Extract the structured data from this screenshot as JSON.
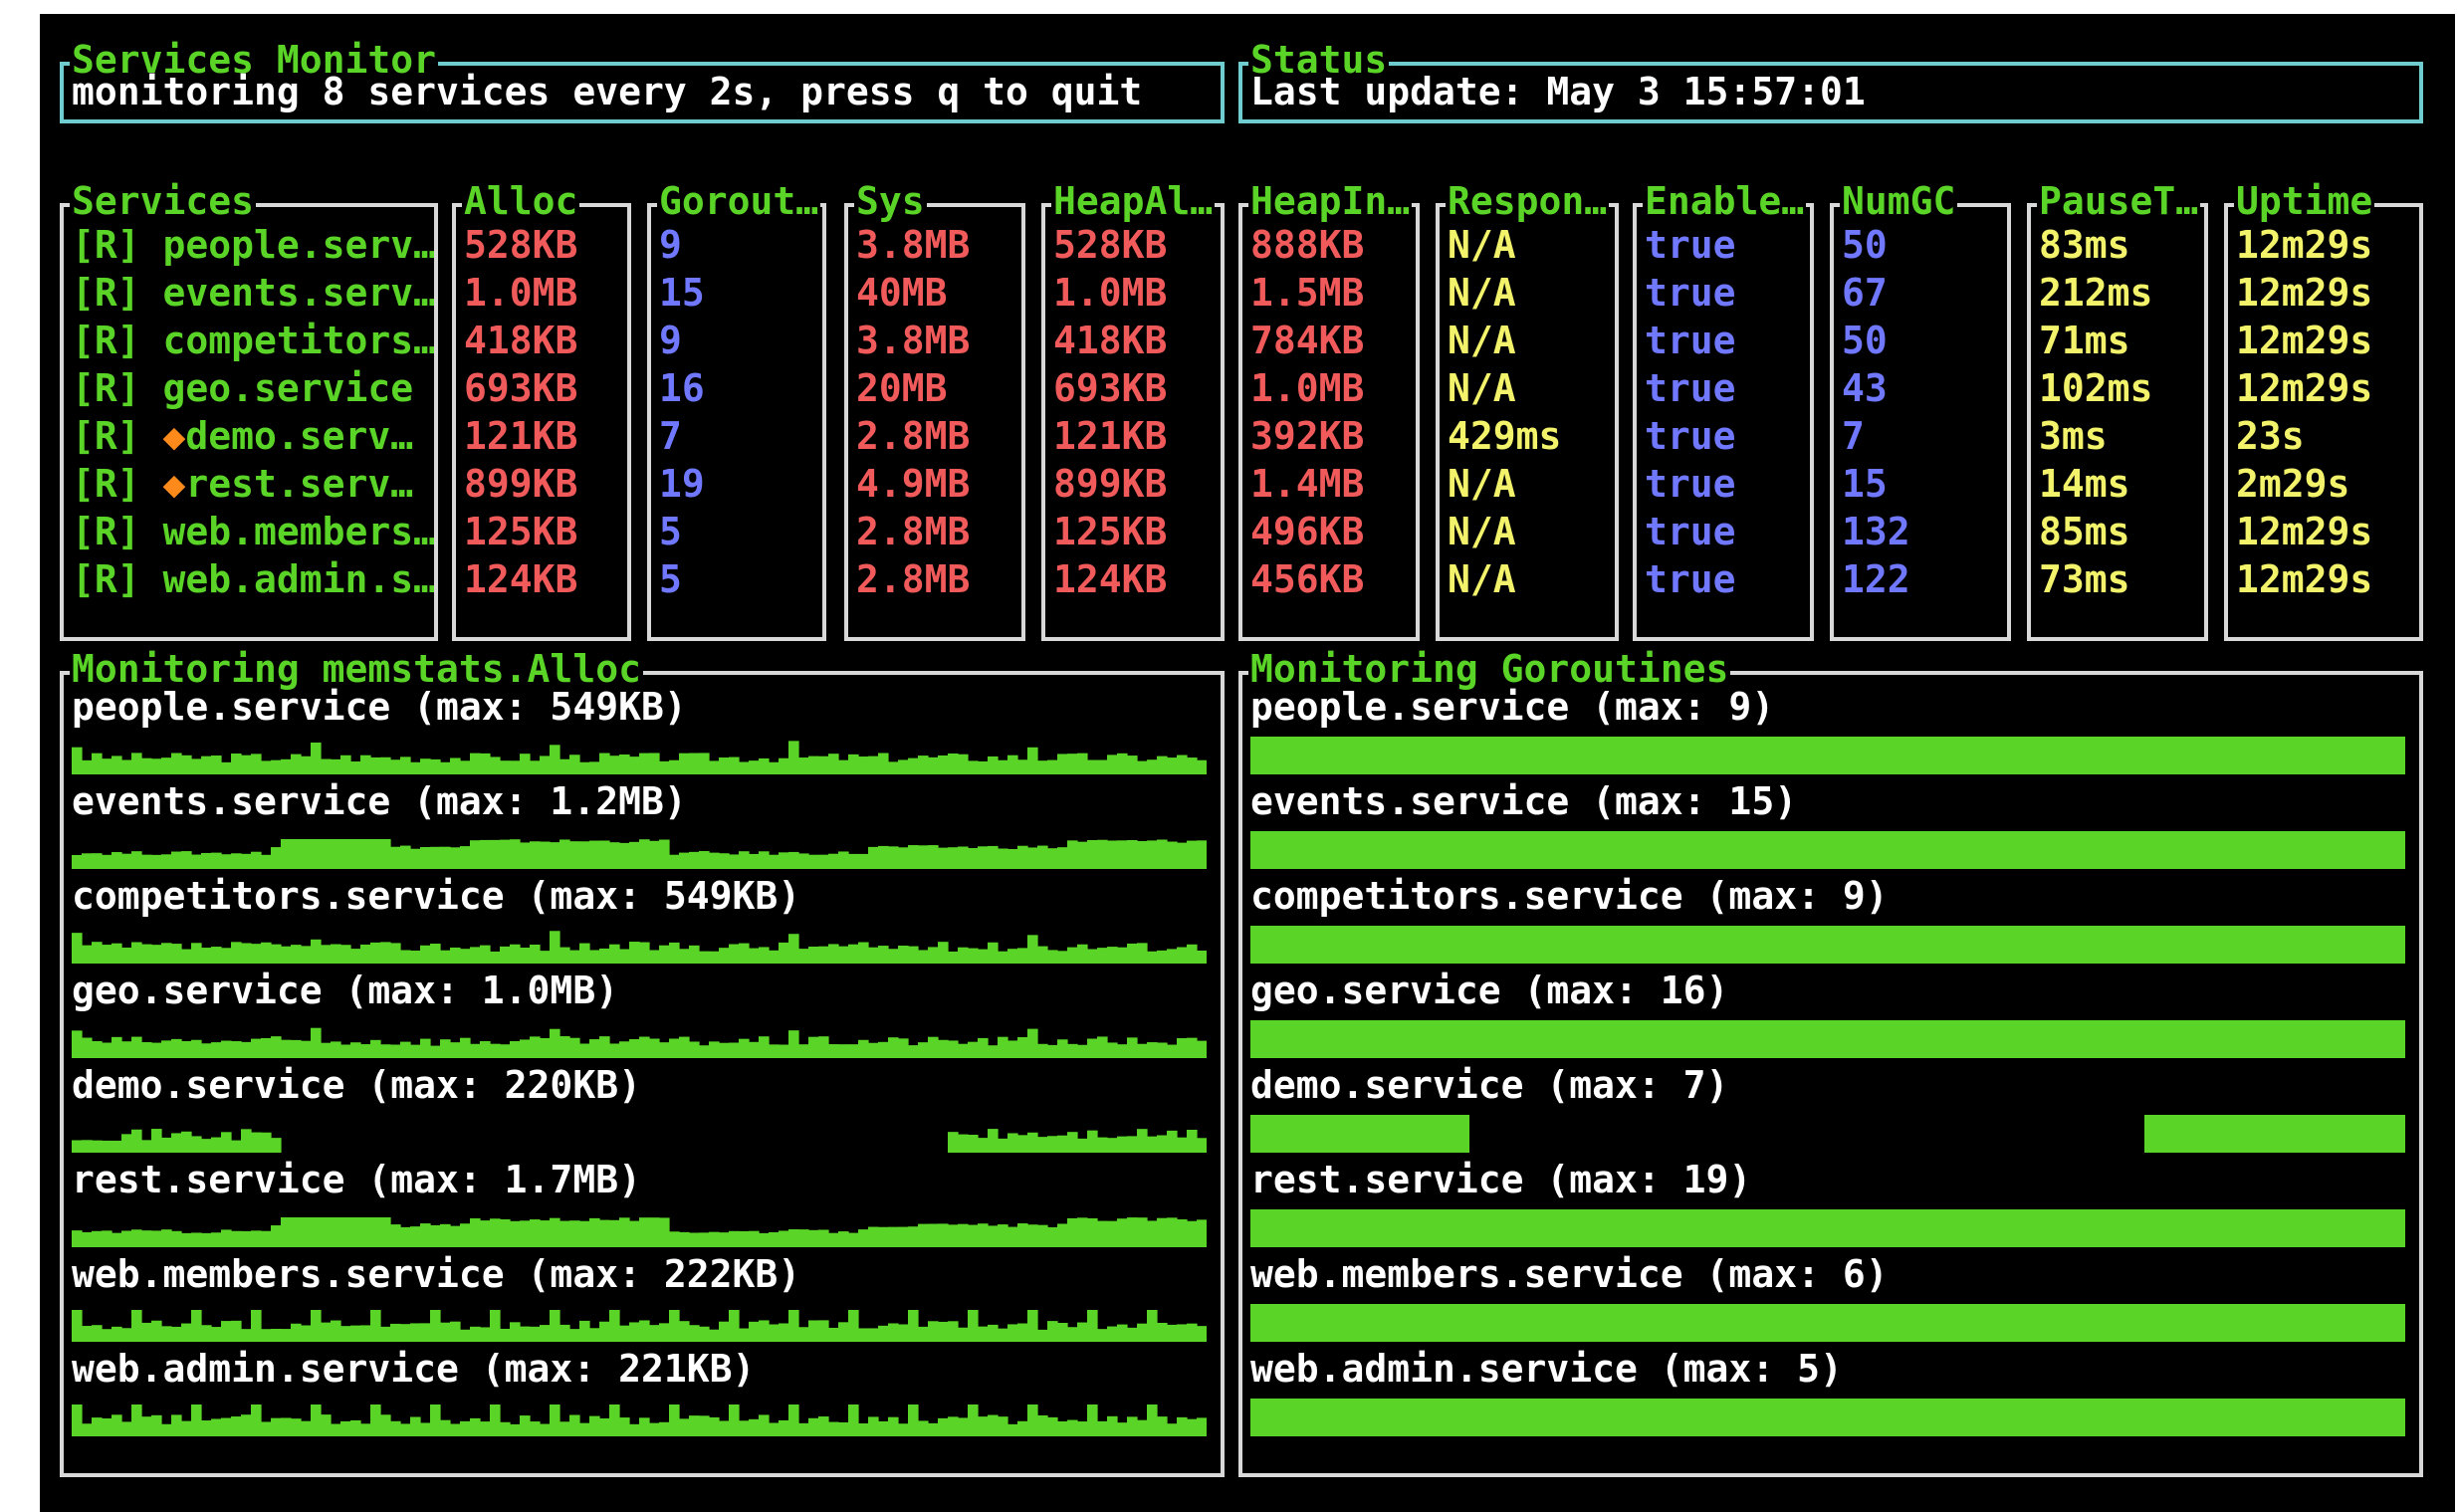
{
  "header": {
    "title": "Services Monitor",
    "subtitle": "monitoring 8 services every 2s, press q to quit"
  },
  "status": {
    "title": "Status",
    "last_update": "Last update: May  3 15:57:01"
  },
  "columns": [
    "Services",
    "Alloc",
    "Gorout…",
    "Sys",
    "HeapAl…",
    "HeapIn…",
    "Respon…",
    "Enable…",
    "NumGC",
    "PauseT…",
    "Uptime"
  ],
  "services": [
    {
      "name": "[R] people.serv…",
      "alloc": "528KB",
      "goroutines": "9",
      "sys": "3.8MB",
      "heapalloc": "528KB",
      "heapinuse": "888KB",
      "response": "N/A",
      "enabled": "true",
      "numgc": "50",
      "pause": "83ms",
      "uptime": "12m29s"
    },
    {
      "name": "[R] events.serv…",
      "alloc": "1.0MB",
      "goroutines": "15",
      "sys": "40MB",
      "heapalloc": "1.0MB",
      "heapinuse": "1.5MB",
      "response": "N/A",
      "enabled": "true",
      "numgc": "67",
      "pause": "212ms",
      "uptime": "12m29s"
    },
    {
      "name": "[R] competitors…",
      "alloc": "418KB",
      "goroutines": "9",
      "sys": "3.8MB",
      "heapalloc": "418KB",
      "heapinuse": "784KB",
      "response": "N/A",
      "enabled": "true",
      "numgc": "50",
      "pause": "71ms",
      "uptime": "12m29s"
    },
    {
      "name": "[R] geo.service",
      "alloc": "693KB",
      "goroutines": "16",
      "sys": "20MB",
      "heapalloc": "693KB",
      "heapinuse": "1.0MB",
      "response": "N/A",
      "enabled": "true",
      "numgc": "43",
      "pause": "102ms",
      "uptime": "12m29s"
    },
    {
      "name": "[R] 🔥demo.serv…",
      "alloc": "121KB",
      "goroutines": "7",
      "sys": "2.8MB",
      "heapalloc": "121KB",
      "heapinuse": "392KB",
      "response": "429ms",
      "enabled": "true",
      "numgc": "7",
      "pause": "3ms",
      "uptime": "23s"
    },
    {
      "name": "[R] 🔥rest.serv…",
      "alloc": "899KB",
      "goroutines": "19",
      "sys": "4.9MB",
      "heapalloc": "899KB",
      "heapinuse": "1.4MB",
      "response": "N/A",
      "enabled": "true",
      "numgc": "15",
      "pause": "14ms",
      "uptime": "2m29s"
    },
    {
      "name": "[R] web.members…",
      "alloc": "125KB",
      "goroutines": "5",
      "sys": "2.8MB",
      "heapalloc": "125KB",
      "heapinuse": "496KB",
      "response": "N/A",
      "enabled": "true",
      "numgc": "132",
      "pause": "85ms",
      "uptime": "12m29s"
    },
    {
      "name": "[R] web.admin.s…",
      "alloc": "124KB",
      "goroutines": "5",
      "sys": "2.8MB",
      "heapalloc": "124KB",
      "heapinuse": "456KB",
      "response": "N/A",
      "enabled": "true",
      "numgc": "122",
      "pause": "73ms",
      "uptime": "12m29s"
    }
  ],
  "alloc_panel": {
    "title": "Monitoring memstats.Alloc",
    "items": [
      {
        "label": "people.service (max: 549KB)",
        "pattern": "noisy-flat"
      },
      {
        "label": "events.service (max: 1.2MB)",
        "pattern": "blocky"
      },
      {
        "label": "competitors.service (max: 549KB)",
        "pattern": "noisy-flat"
      },
      {
        "label": "geo.service (max: 1.0MB)",
        "pattern": "noisy-flat"
      },
      {
        "label": "demo.service (max: 220KB)",
        "pattern": "gap"
      },
      {
        "label": "rest.service (max: 1.7MB)",
        "pattern": "blocky"
      },
      {
        "label": "web.members.service (max: 222KB)",
        "pattern": "spiky"
      },
      {
        "label": "web.admin.service (max: 221KB)",
        "pattern": "spiky"
      }
    ]
  },
  "goroutine_panel": {
    "title": "Monitoring Goroutines",
    "items": [
      {
        "label": "people.service (max: 9)",
        "gap": false
      },
      {
        "label": "events.service (max: 15)",
        "gap": false
      },
      {
        "label": "competitors.service (max: 9)",
        "gap": false
      },
      {
        "label": "geo.service (max: 16)",
        "gap": false
      },
      {
        "label": "demo.service (max: 7)",
        "gap": true
      },
      {
        "label": "rest.service (max: 19)",
        "gap": false
      },
      {
        "label": "web.members.service (max: 6)",
        "gap": false
      },
      {
        "label": "web.admin.service (max: 5)",
        "gap": false
      }
    ]
  },
  "colors": {
    "title_green": "#5ad426",
    "border_cyan": "#6fcdcf",
    "alloc_red": "#f05a5a",
    "goroutine_blue": "#6f78ff",
    "response_yellow": "#f3f26b",
    "spark_green": "#5ad426"
  }
}
